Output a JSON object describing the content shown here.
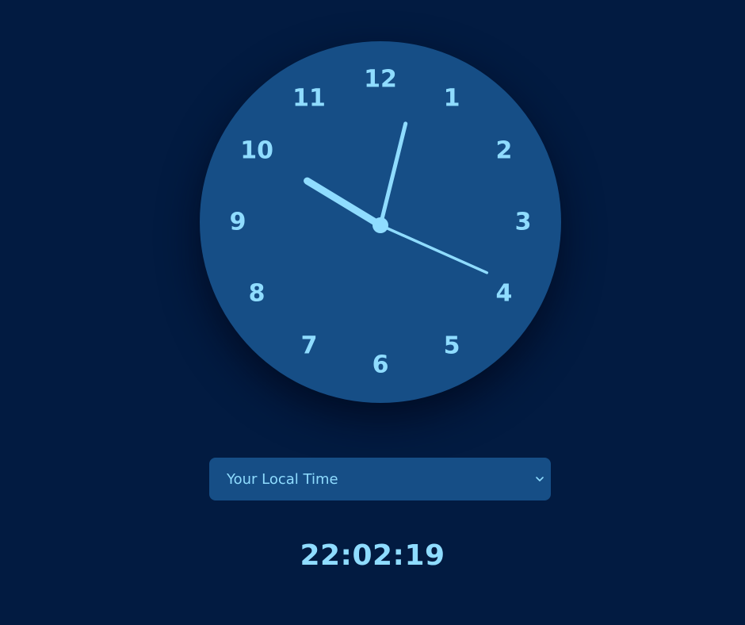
{
  "clock": {
    "numerals": [
      "12",
      "1",
      "2",
      "3",
      "4",
      "5",
      "6",
      "7",
      "8",
      "9",
      "10",
      "11"
    ],
    "time": {
      "hours": 22,
      "minutes": 2,
      "seconds": 19
    }
  },
  "timezone_select": {
    "selected_label": "Your Local Time",
    "icon": "chevron-down-icon"
  },
  "digital_time": "22:02:19",
  "colors": {
    "background": "#021b41",
    "clock_face": "#164e86",
    "accent": "#8fdcff"
  }
}
